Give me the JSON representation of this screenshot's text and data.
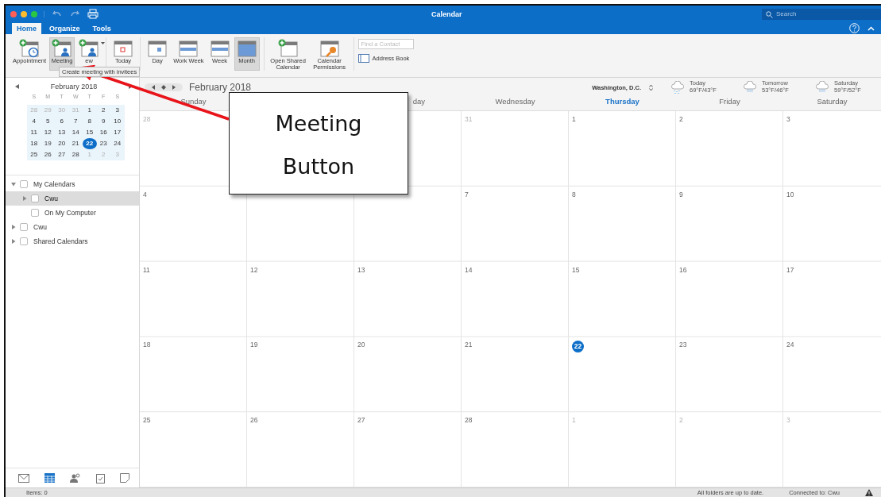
{
  "window": {
    "title": "Calendar"
  },
  "search": {
    "placeholder": "Search"
  },
  "tabs": [
    {
      "label": "Home",
      "selected": true
    },
    {
      "label": "Organize",
      "selected": false
    },
    {
      "label": "Tools",
      "selected": false
    }
  ],
  "ribbon": {
    "groups": [
      [
        {
          "label": "Appointment",
          "kind": "appointment",
          "selected": false
        },
        {
          "label": "Meeting",
          "kind": "meeting",
          "selected": true
        },
        {
          "label": "ew",
          "kind": "new",
          "selected": false
        }
      ],
      [
        {
          "label": "Today",
          "kind": "today",
          "selected": false
        }
      ],
      [
        {
          "label": "Day",
          "kind": "day",
          "selected": false
        },
        {
          "label": "Work Week",
          "kind": "workweek",
          "selected": false
        },
        {
          "label": "Week",
          "kind": "week",
          "selected": false
        },
        {
          "label": "Month",
          "kind": "month",
          "selected": true
        }
      ],
      [
        {
          "label": "Open Shared Calendar",
          "kind": "shared",
          "selected": false
        },
        {
          "label": "Calendar Permissions",
          "kind": "permissions",
          "selected": false
        }
      ]
    ],
    "contact_search": {
      "placeholder": "Find a Contact"
    },
    "address_book": "Address Book"
  },
  "tooltip": "Create meeting with invitees",
  "mini_calendar": {
    "title": "February 2018",
    "weekdays": [
      "S",
      "M",
      "T",
      "W",
      "T",
      "F",
      "S"
    ],
    "weeks": [
      [
        {
          "day": "28",
          "muted": true,
          "selected": false
        },
        {
          "day": "29",
          "muted": true,
          "selected": false
        },
        {
          "day": "30",
          "muted": true,
          "selected": false
        },
        {
          "day": "31",
          "muted": true,
          "selected": false
        },
        {
          "day": "1",
          "muted": false,
          "selected": false
        },
        {
          "day": "2",
          "muted": false,
          "selected": false
        },
        {
          "day": "3",
          "muted": false,
          "selected": false
        }
      ],
      [
        {
          "day": "4",
          "muted": false,
          "selected": false
        },
        {
          "day": "5",
          "muted": false,
          "selected": false
        },
        {
          "day": "6",
          "muted": false,
          "selected": false
        },
        {
          "day": "7",
          "muted": false,
          "selected": false
        },
        {
          "day": "8",
          "muted": false,
          "selected": false
        },
        {
          "day": "9",
          "muted": false,
          "selected": false
        },
        {
          "day": "10",
          "muted": false,
          "selected": false
        }
      ],
      [
        {
          "day": "11",
          "muted": false,
          "selected": false
        },
        {
          "day": "12",
          "muted": false,
          "selected": false
        },
        {
          "day": "13",
          "muted": false,
          "selected": false
        },
        {
          "day": "14",
          "muted": false,
          "selected": false
        },
        {
          "day": "15",
          "muted": false,
          "selected": false
        },
        {
          "day": "16",
          "muted": false,
          "selected": false
        },
        {
          "day": "17",
          "muted": false,
          "selected": false
        }
      ],
      [
        {
          "day": "18",
          "muted": false,
          "selected": false
        },
        {
          "day": "19",
          "muted": false,
          "selected": false
        },
        {
          "day": "20",
          "muted": false,
          "selected": false
        },
        {
          "day": "21",
          "muted": false,
          "selected": false
        },
        {
          "day": "22",
          "muted": false,
          "selected": true
        },
        {
          "day": "23",
          "muted": false,
          "selected": false
        },
        {
          "day": "24",
          "muted": false,
          "selected": false
        }
      ],
      [
        {
          "day": "25",
          "muted": false,
          "selected": false
        },
        {
          "day": "26",
          "muted": false,
          "selected": false
        },
        {
          "day": "27",
          "muted": false,
          "selected": false
        },
        {
          "day": "28",
          "muted": false,
          "selected": false
        },
        {
          "day": "1",
          "muted": true,
          "selected": false
        },
        {
          "day": "2",
          "muted": true,
          "selected": false
        },
        {
          "day": "3",
          "muted": true,
          "selected": false
        }
      ]
    ]
  },
  "folders": [
    {
      "label": "My Calendars",
      "expanded": true,
      "checked": false,
      "selected": false,
      "children": [
        {
          "label": "Cwu",
          "expanded": false,
          "checked": false,
          "selected": true
        },
        {
          "label": "On My Computer",
          "checked": false,
          "selected": false
        }
      ]
    },
    {
      "label": "Cwu",
      "expanded": false,
      "checked": false,
      "selected": false
    },
    {
      "label": "Shared Calendars",
      "expanded": false,
      "checked": false,
      "selected": false
    }
  ],
  "nav": [
    {
      "kind": "mail",
      "selected": false
    },
    {
      "kind": "calendar",
      "selected": true
    },
    {
      "kind": "people",
      "selected": false
    },
    {
      "kind": "tasks",
      "selected": false
    },
    {
      "kind": "notes",
      "selected": false
    }
  ],
  "calendar": {
    "title": "February 2018",
    "location": "Washington, D.C.",
    "weather": [
      {
        "label": "Today",
        "temps": "69°F/43°F",
        "kind": "rain"
      },
      {
        "label": "Tomorrow",
        "temps": "53°F/46°F",
        "kind": "showers"
      },
      {
        "label": "Saturday",
        "temps": "59°F/52°F",
        "kind": "showers"
      }
    ],
    "columns": [
      {
        "kind": "heading",
        "label": "Sunday",
        "today": false
      },
      {
        "kind": "covered"
      },
      {
        "kind": "heading",
        "label": "day",
        "today": false
      },
      {
        "kind": "heading",
        "label": "Wednesday",
        "today": false
      },
      {
        "kind": "heading",
        "label": "Thursday",
        "today": true
      },
      {
        "kind": "heading",
        "label": "Friday",
        "today": false
      },
      {
        "kind": "heading",
        "label": "Saturday",
        "today": false
      }
    ],
    "weeks": [
      [
        {
          "date": "28",
          "muted": true,
          "today": false
        },
        {
          "date": "31",
          "muted": true,
          "today": false
        },
        {
          "date": "1",
          "muted": false,
          "today": false
        },
        {
          "date": "2",
          "muted": false,
          "today": false
        },
        {
          "date": "3",
          "muted": false,
          "today": false
        }
      ],
      [
        {
          "date": "4",
          "muted": false,
          "today": false
        },
        {
          "date": "7",
          "muted": false,
          "today": false
        },
        {
          "date": "8",
          "muted": false,
          "today": false
        },
        {
          "date": "9",
          "muted": false,
          "today": false
        },
        {
          "date": "10",
          "muted": false,
          "today": false
        }
      ],
      [
        {
          "date": "11",
          "muted": false,
          "today": false
        },
        {
          "date": "12",
          "muted": false,
          "today": false
        },
        {
          "date": "13",
          "muted": false,
          "today": false
        },
        {
          "date": "14",
          "muted": false,
          "today": false
        },
        {
          "date": "15",
          "muted": false,
          "today": false
        },
        {
          "date": "16",
          "muted": false,
          "today": false
        },
        {
          "date": "17",
          "muted": false,
          "today": false
        }
      ],
      [
        {
          "date": "18",
          "muted": false,
          "today": false
        },
        {
          "date": "19",
          "muted": false,
          "today": false
        },
        {
          "date": "20",
          "muted": false,
          "today": false
        },
        {
          "date": "21",
          "muted": false,
          "today": false
        },
        {
          "date": "22",
          "muted": false,
          "today": true
        },
        {
          "date": "23",
          "muted": false,
          "today": false
        },
        {
          "date": "24",
          "muted": false,
          "today": false
        }
      ],
      [
        {
          "date": "25",
          "muted": false,
          "today": false
        },
        {
          "date": "26",
          "muted": false,
          "today": false
        },
        {
          "date": "27",
          "muted": false,
          "today": false
        },
        {
          "date": "28",
          "muted": false,
          "today": false
        },
        {
          "date": "1",
          "muted": true,
          "today": false
        },
        {
          "date": "2",
          "muted": true,
          "today": false
        },
        {
          "date": "3",
          "muted": true,
          "today": false
        }
      ]
    ]
  },
  "callout": "Meeting Button",
  "status_bar": {
    "items": "Items: 0",
    "sync": "All folders are up to date.",
    "connection": "Connected to: Cwu"
  }
}
